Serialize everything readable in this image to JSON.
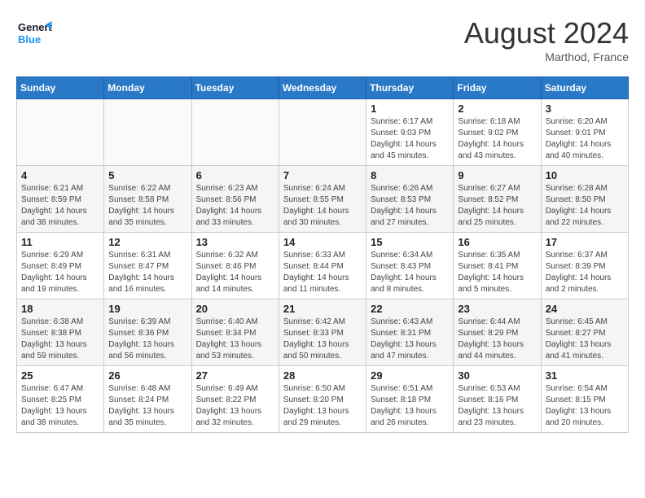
{
  "header": {
    "logo_line1": "General",
    "logo_line2": "Blue",
    "month_year": "August 2024",
    "location": "Marthod, France"
  },
  "weekdays": [
    "Sunday",
    "Monday",
    "Tuesday",
    "Wednesday",
    "Thursday",
    "Friday",
    "Saturday"
  ],
  "weeks": [
    [
      {
        "day": "",
        "info": ""
      },
      {
        "day": "",
        "info": ""
      },
      {
        "day": "",
        "info": ""
      },
      {
        "day": "",
        "info": ""
      },
      {
        "day": "1",
        "info": "Sunrise: 6:17 AM\nSunset: 9:03 PM\nDaylight: 14 hours\nand 45 minutes."
      },
      {
        "day": "2",
        "info": "Sunrise: 6:18 AM\nSunset: 9:02 PM\nDaylight: 14 hours\nand 43 minutes."
      },
      {
        "day": "3",
        "info": "Sunrise: 6:20 AM\nSunset: 9:01 PM\nDaylight: 14 hours\nand 40 minutes."
      }
    ],
    [
      {
        "day": "4",
        "info": "Sunrise: 6:21 AM\nSunset: 8:59 PM\nDaylight: 14 hours\nand 38 minutes."
      },
      {
        "day": "5",
        "info": "Sunrise: 6:22 AM\nSunset: 8:58 PM\nDaylight: 14 hours\nand 35 minutes."
      },
      {
        "day": "6",
        "info": "Sunrise: 6:23 AM\nSunset: 8:56 PM\nDaylight: 14 hours\nand 33 minutes."
      },
      {
        "day": "7",
        "info": "Sunrise: 6:24 AM\nSunset: 8:55 PM\nDaylight: 14 hours\nand 30 minutes."
      },
      {
        "day": "8",
        "info": "Sunrise: 6:26 AM\nSunset: 8:53 PM\nDaylight: 14 hours\nand 27 minutes."
      },
      {
        "day": "9",
        "info": "Sunrise: 6:27 AM\nSunset: 8:52 PM\nDaylight: 14 hours\nand 25 minutes."
      },
      {
        "day": "10",
        "info": "Sunrise: 6:28 AM\nSunset: 8:50 PM\nDaylight: 14 hours\nand 22 minutes."
      }
    ],
    [
      {
        "day": "11",
        "info": "Sunrise: 6:29 AM\nSunset: 8:49 PM\nDaylight: 14 hours\nand 19 minutes."
      },
      {
        "day": "12",
        "info": "Sunrise: 6:31 AM\nSunset: 8:47 PM\nDaylight: 14 hours\nand 16 minutes."
      },
      {
        "day": "13",
        "info": "Sunrise: 6:32 AM\nSunset: 8:46 PM\nDaylight: 14 hours\nand 14 minutes."
      },
      {
        "day": "14",
        "info": "Sunrise: 6:33 AM\nSunset: 8:44 PM\nDaylight: 14 hours\nand 11 minutes."
      },
      {
        "day": "15",
        "info": "Sunrise: 6:34 AM\nSunset: 8:43 PM\nDaylight: 14 hours\nand 8 minutes."
      },
      {
        "day": "16",
        "info": "Sunrise: 6:35 AM\nSunset: 8:41 PM\nDaylight: 14 hours\nand 5 minutes."
      },
      {
        "day": "17",
        "info": "Sunrise: 6:37 AM\nSunset: 8:39 PM\nDaylight: 14 hours\nand 2 minutes."
      }
    ],
    [
      {
        "day": "18",
        "info": "Sunrise: 6:38 AM\nSunset: 8:38 PM\nDaylight: 13 hours\nand 59 minutes."
      },
      {
        "day": "19",
        "info": "Sunrise: 6:39 AM\nSunset: 8:36 PM\nDaylight: 13 hours\nand 56 minutes."
      },
      {
        "day": "20",
        "info": "Sunrise: 6:40 AM\nSunset: 8:34 PM\nDaylight: 13 hours\nand 53 minutes."
      },
      {
        "day": "21",
        "info": "Sunrise: 6:42 AM\nSunset: 8:33 PM\nDaylight: 13 hours\nand 50 minutes."
      },
      {
        "day": "22",
        "info": "Sunrise: 6:43 AM\nSunset: 8:31 PM\nDaylight: 13 hours\nand 47 minutes."
      },
      {
        "day": "23",
        "info": "Sunrise: 6:44 AM\nSunset: 8:29 PM\nDaylight: 13 hours\nand 44 minutes."
      },
      {
        "day": "24",
        "info": "Sunrise: 6:45 AM\nSunset: 8:27 PM\nDaylight: 13 hours\nand 41 minutes."
      }
    ],
    [
      {
        "day": "25",
        "info": "Sunrise: 6:47 AM\nSunset: 8:25 PM\nDaylight: 13 hours\nand 38 minutes."
      },
      {
        "day": "26",
        "info": "Sunrise: 6:48 AM\nSunset: 8:24 PM\nDaylight: 13 hours\nand 35 minutes."
      },
      {
        "day": "27",
        "info": "Sunrise: 6:49 AM\nSunset: 8:22 PM\nDaylight: 13 hours\nand 32 minutes."
      },
      {
        "day": "28",
        "info": "Sunrise: 6:50 AM\nSunset: 8:20 PM\nDaylight: 13 hours\nand 29 minutes."
      },
      {
        "day": "29",
        "info": "Sunrise: 6:51 AM\nSunset: 8:18 PM\nDaylight: 13 hours\nand 26 minutes."
      },
      {
        "day": "30",
        "info": "Sunrise: 6:53 AM\nSunset: 8:16 PM\nDaylight: 13 hours\nand 23 minutes."
      },
      {
        "day": "31",
        "info": "Sunrise: 6:54 AM\nSunset: 8:15 PM\nDaylight: 13 hours\nand 20 minutes."
      }
    ]
  ]
}
